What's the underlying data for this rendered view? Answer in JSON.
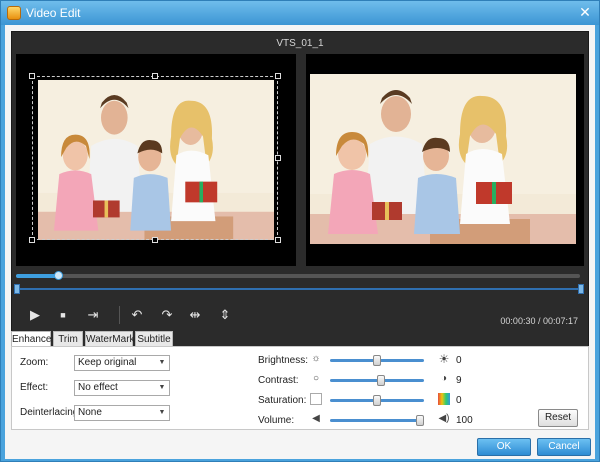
{
  "window": {
    "title": "Video Edit",
    "close_glyph": "✕"
  },
  "player": {
    "file_title": "VTS_01_1",
    "time_display": "00:00:30 / 00:07:17",
    "seek_progress_percent": 7,
    "controls": [
      "play-icon",
      "stop-icon",
      "snapshot-icon",
      "rotate-left-icon",
      "rotate-right-icon",
      "flip-horizontal-icon",
      "flip-vertical-icon"
    ]
  },
  "tabs": [
    "Enhance",
    "Trim",
    "WaterMark",
    "Subtitle"
  ],
  "enhance": {
    "zoom_label": "Zoom:",
    "zoom_value": "Keep original",
    "effect_label": "Effect:",
    "effect_value": "No effect",
    "deinterlacing_label": "Deinterlacing:",
    "deinterlacing_value": "None",
    "brightness_label": "Brightness:",
    "brightness_value": "0",
    "contrast_label": "Contrast:",
    "contrast_value": "9",
    "saturation_label": "Saturation:",
    "saturation_value": "0",
    "volume_label": "Volume:",
    "volume_value": "100",
    "reset_label": "Reset"
  },
  "footer": {
    "ok_label": "OK",
    "cancel_label": "Cancel"
  },
  "colors": {
    "accent": "#3e9fe0",
    "titlebar": "#4aa3dd",
    "player_bg": "#2b2b2b"
  }
}
